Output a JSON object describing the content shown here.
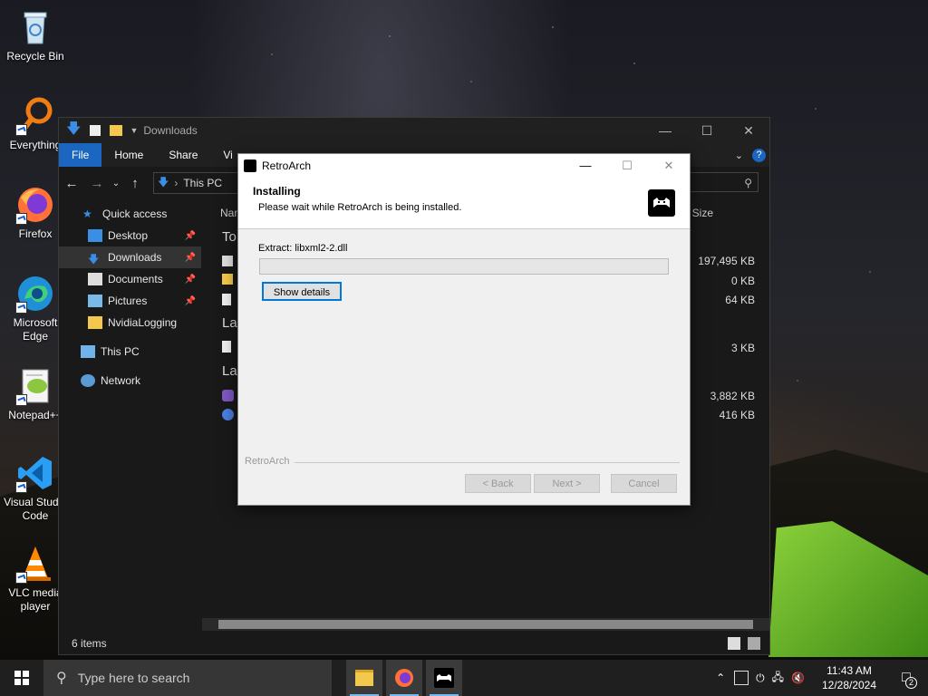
{
  "desktop": {
    "icons": [
      {
        "label": "Recycle Bin"
      },
      {
        "label": "Everything"
      },
      {
        "label": "Firefox"
      },
      {
        "label": "Microsoft Edge"
      },
      {
        "label": "Notepad++"
      },
      {
        "label": "Visual Studio Code"
      },
      {
        "label": "VLC media player"
      }
    ]
  },
  "explorer": {
    "title": "Downloads",
    "ribbon": [
      "File",
      "Home",
      "Share",
      "Vi"
    ],
    "address": {
      "segment1": "This PC"
    },
    "nav": [
      {
        "label": "Quick access"
      },
      {
        "label": "Desktop"
      },
      {
        "label": "Downloads"
      },
      {
        "label": "Documents"
      },
      {
        "label": "Pictures"
      },
      {
        "label": "NvidiaLogging"
      },
      {
        "label": "This PC"
      },
      {
        "label": "Network"
      }
    ],
    "columns": {
      "name": "Nan",
      "size": "Size"
    },
    "groups": [
      "To",
      "Las",
      "Las"
    ],
    "sizes": [
      "197,495 KB",
      "0 KB",
      "64 KB",
      "3 KB",
      "3,882 KB",
      "416 KB"
    ],
    "status": "6 items"
  },
  "installer": {
    "title": "RetroArch",
    "heading": "Installing",
    "subheading": "Please wait while RetroArch is being installed.",
    "extract": "Extract: libxml2-2.dll",
    "progress": 0,
    "show_details": "Show details",
    "brand": "RetroArch",
    "back": "< Back",
    "next": "Next >",
    "cancel": "Cancel"
  },
  "taskbar": {
    "search_placeholder": "Type here to search",
    "time": "11:43 AM",
    "date": "12/28/2024",
    "notifications": "2"
  }
}
